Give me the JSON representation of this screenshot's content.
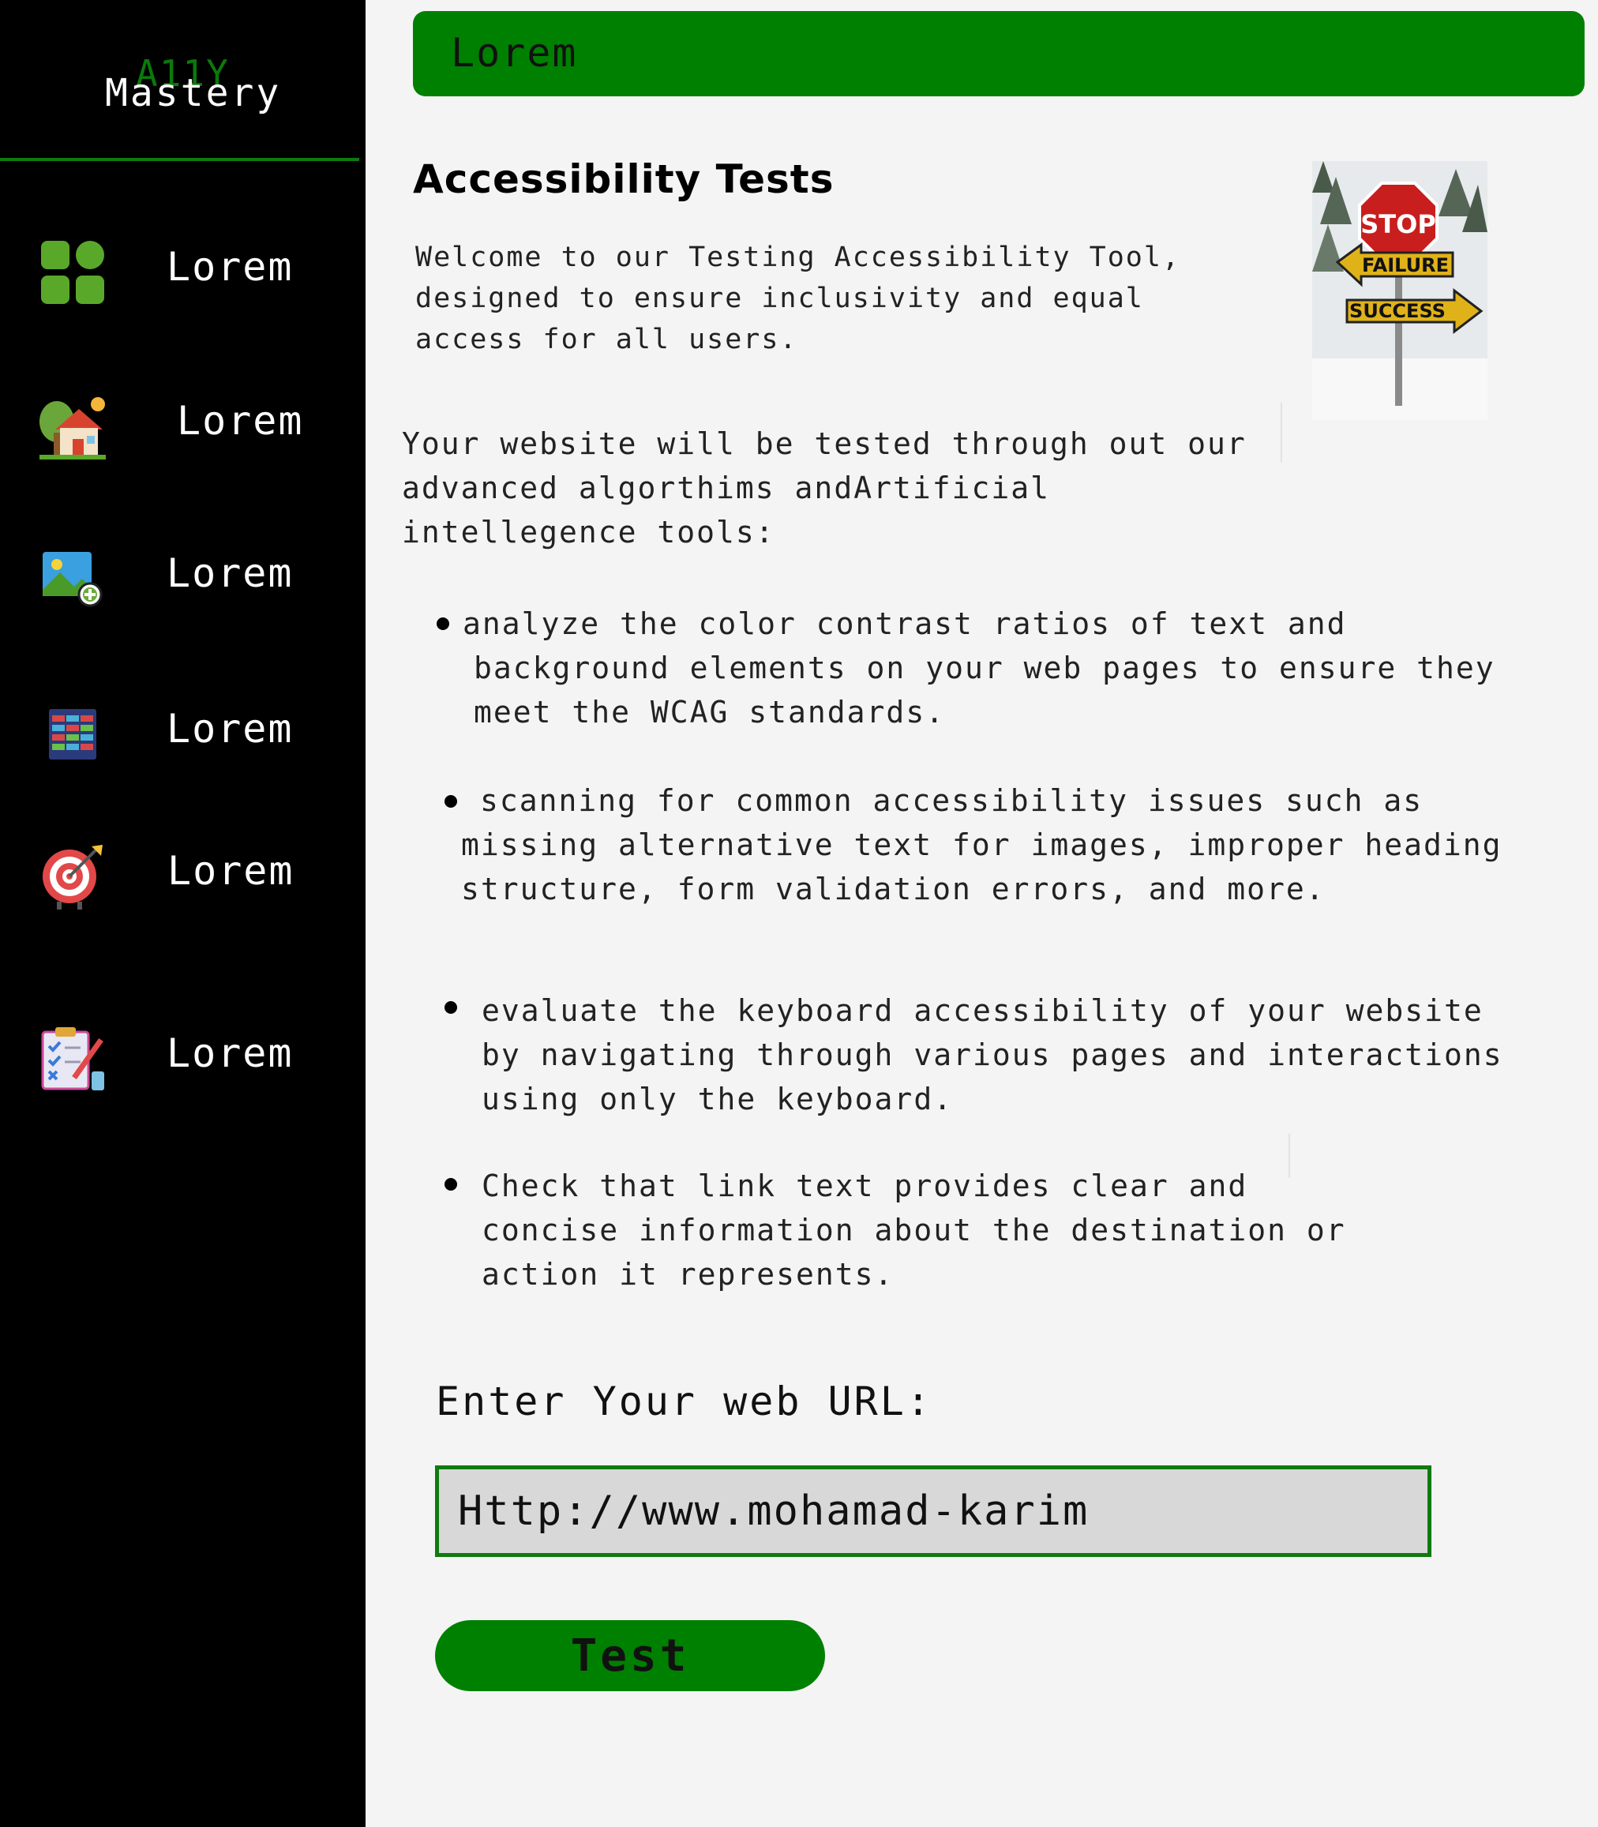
{
  "logo": {
    "a11y": "A11Y",
    "mastery": "Mastery"
  },
  "sidebar": {
    "items": [
      {
        "label": "Lorem",
        "icon": "dashboard-grid-icon"
      },
      {
        "label": "Lorem",
        "icon": "house-icon"
      },
      {
        "label": "Lorem",
        "icon": "add-image-icon"
      },
      {
        "label": "Lorem",
        "icon": "spreadsheet-icon"
      },
      {
        "label": "Lorem",
        "icon": "target-icon"
      },
      {
        "label": "Lorem",
        "icon": "checklist-icon"
      }
    ]
  },
  "header": {
    "title": "Lorem"
  },
  "main": {
    "title": "Accessibility Tests",
    "welcome": "Welcome to our Testing Accessibility Tool, designed to ensure inclusivity and equal access for all users.",
    "intro": "Your website will be tested through out our advanced algorthims andArtificial intellegence tools:",
    "bullets": [
      " analyze the color contrast ratios of text and background elements on your web pages to ensure they meet the WCAG standards.",
      "scanning for common accessibility issues such as missing alternative text for images, improper heading structure, form validation errors, and more.",
      "evaluate the keyboard accessibility of your website by navigating through various pages and interactions using only the keyboard.",
      "Check that link text provides clear and concise information about the destination or action it represents."
    ]
  },
  "sign": {
    "stop": "STOP",
    "failure": "FAILURE",
    "success": "SUCCESS"
  },
  "url_form": {
    "label": "Enter Your web URL:",
    "value": "Http://www.mohamad-karim",
    "button": "Test"
  },
  "colors": {
    "accent": "#008000",
    "sidebar_bg": "#000000",
    "page_bg": "#f4f4f4"
  }
}
